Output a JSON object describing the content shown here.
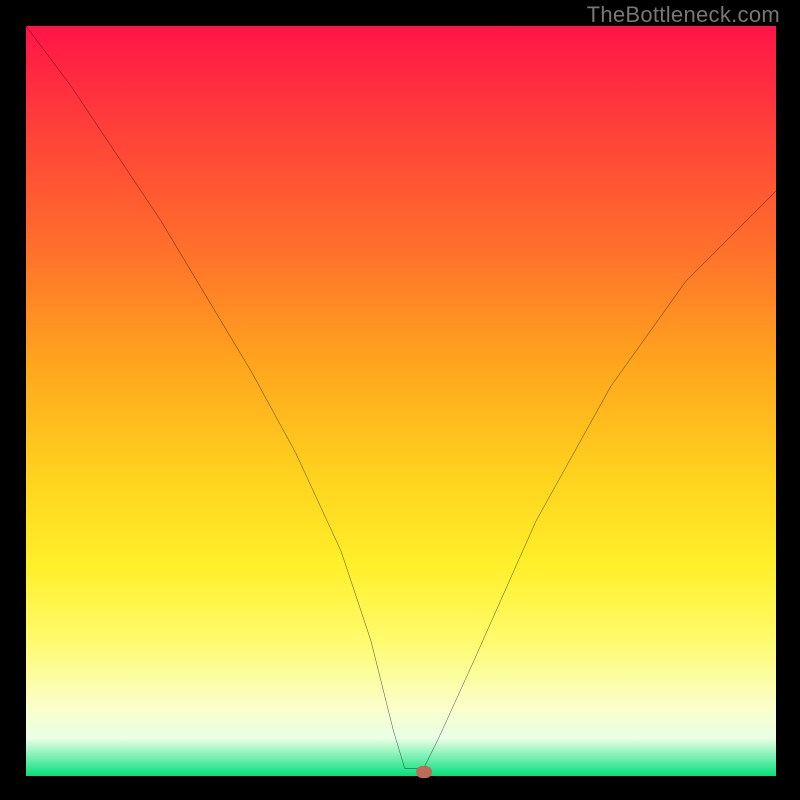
{
  "watermark": "TheBottleneck.com",
  "chart_data": {
    "type": "line",
    "title": "",
    "xlabel": "",
    "ylabel": "",
    "xlim": [
      0,
      100
    ],
    "ylim": [
      0,
      100
    ],
    "grid": false,
    "legend": false,
    "series": [
      {
        "name": "bottleneck-curve",
        "x": [
          0,
          6,
          12,
          18,
          24,
          30,
          36,
          42,
          46,
          49,
          50.5,
          52,
          53,
          55,
          60,
          68,
          78,
          88,
          100
        ],
        "y": [
          100,
          92,
          83,
          74,
          64,
          54,
          43,
          30,
          18,
          6,
          1,
          1,
          1,
          5,
          16,
          34,
          52,
          66,
          78
        ]
      }
    ],
    "gradient_stops": [
      {
        "pos": 0.0,
        "color": "#ff1448"
      },
      {
        "pos": 0.12,
        "color": "#ff3b3b"
      },
      {
        "pos": 0.28,
        "color": "#ff6a2d"
      },
      {
        "pos": 0.45,
        "color": "#ffa51d"
      },
      {
        "pos": 0.6,
        "color": "#ffd21e"
      },
      {
        "pos": 0.72,
        "color": "#fff02a"
      },
      {
        "pos": 0.82,
        "color": "#fffb6e"
      },
      {
        "pos": 0.91,
        "color": "#faffcb"
      },
      {
        "pos": 0.95,
        "color": "#e9ffe6"
      },
      {
        "pos": 1.0,
        "color": "#04e07a"
      }
    ],
    "marker": {
      "x": 53,
      "y": 0.5,
      "color": "#c16a5a"
    }
  }
}
